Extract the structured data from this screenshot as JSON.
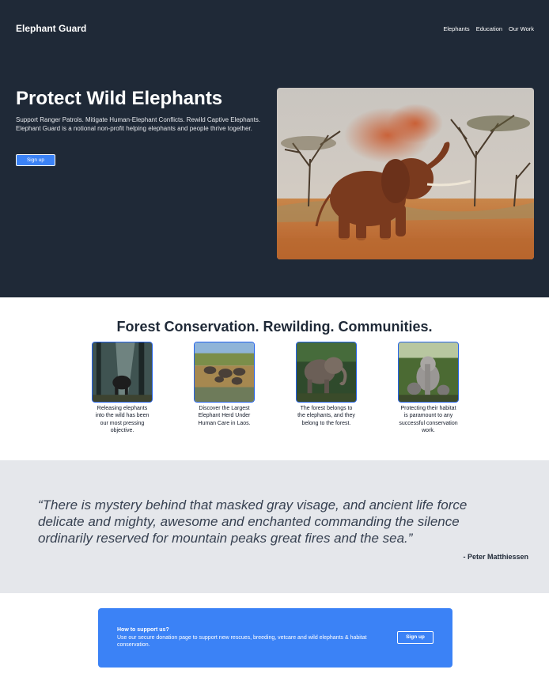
{
  "header": {
    "brand": "Elephant Guard",
    "nav": [
      "Elephants",
      "Education",
      "Our Work"
    ]
  },
  "hero": {
    "title": "Protect Wild Elephants",
    "line1": "Support Ranger Patrols. Mitigate Human-Elephant Conflicts. Rewild Captive Elephants.",
    "line2": "Elephant Guard is a notional non-profit helping elephants and people thrive together.",
    "cta_label": "Sign up"
  },
  "features": {
    "title": "Forest Conservation. Rewilding. Communities.",
    "cards": [
      {
        "caption": "Releasing elephants into the wild has been our most pressing objective."
      },
      {
        "caption": "Discover the Largest Elephant Herd Under Human Care in Laos."
      },
      {
        "caption": "The forest belongs to the elephants, and they belong to the forest."
      },
      {
        "caption": "Protecting their habitat is paramount to any successful conservation work."
      }
    ]
  },
  "quote": {
    "text": "“There is mystery behind that masked gray visage, and ancient life force delicate and mighty, awesome and enchanted commanding the silence ordinarily reserved for mountain peaks great fires and the sea.”",
    "author": "- Peter Matthiessen"
  },
  "support": {
    "heading": "How to support us?",
    "text": "Use our secure donation page to support new rescues, breeding, vetcare and wild elephants & habitat conservation.",
    "cta_label": "Sign up"
  },
  "colors": {
    "hero_bg": "#1f2937",
    "accent": "#3b82f6",
    "quote_bg": "#e5e7eb"
  }
}
